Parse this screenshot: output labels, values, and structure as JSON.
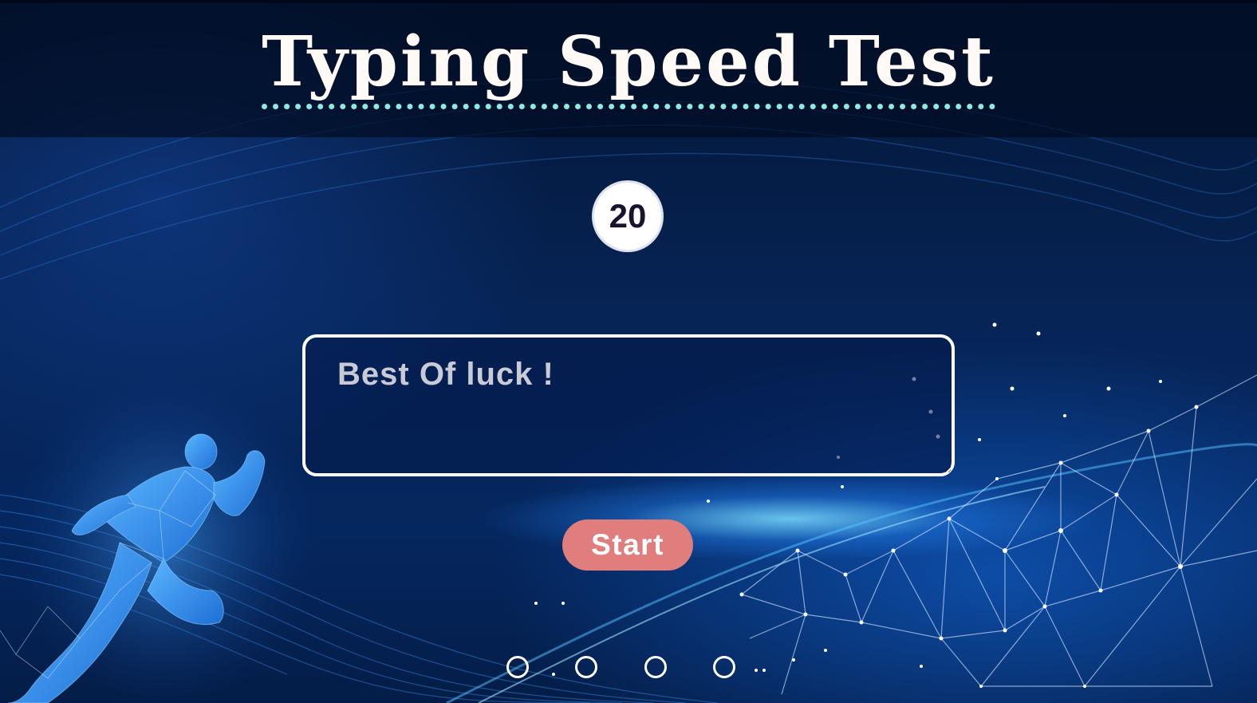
{
  "header": {
    "title": "Typing Speed Test"
  },
  "timer": {
    "value": "20"
  },
  "typing_area": {
    "placeholder": "Best Of luck !",
    "value": ""
  },
  "controls": {
    "start_label": "Start"
  },
  "pagination": {
    "dots": 4,
    "active_index": null
  },
  "colors": {
    "title": "#fffaf6",
    "title_underline": "#8fe9dc",
    "start_button": "#e07d7d",
    "background": "#062456"
  },
  "decor": {
    "icons": [
      "running-man-silhouette",
      "network-mesh"
    ]
  }
}
